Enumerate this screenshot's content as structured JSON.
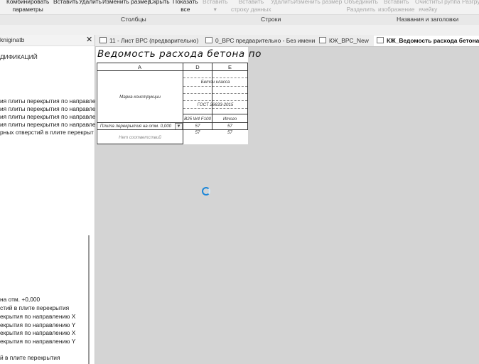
{
  "ribbon": {
    "buttons": [
      {
        "label": "Комбинировать\nпараметры",
        "enabled": true
      },
      {
        "label": "Вставить",
        "enabled": true
      },
      {
        "label": "Удалить",
        "enabled": true
      },
      {
        "label": "Изменить размер",
        "enabled": true
      },
      {
        "label": "Скрыть",
        "enabled": true
      },
      {
        "label": "Показать\nвсе",
        "enabled": true
      },
      {
        "label": "Вставить\n▾",
        "enabled": false
      },
      {
        "label": "Вставить\nстроку данных",
        "enabled": false
      },
      {
        "label": "Удалить",
        "enabled": false
      },
      {
        "label": "Изменить размер",
        "enabled": false
      },
      {
        "label": "Объединить\nРазделить",
        "enabled": false
      },
      {
        "label": "Вставить\nизображение",
        "enabled": false
      },
      {
        "label": "Очистить\nячейку",
        "enabled": false
      },
      {
        "label": "Группа",
        "enabled": false
      },
      {
        "label": "Разгру",
        "enabled": false
      }
    ],
    "groups": [
      "Столбцы",
      "Строки",
      "Названия и заголовки"
    ]
  },
  "left_panel": {
    "title": "kniginatb",
    "close_icon": "close-icon",
    "items_top": [
      "ДИФИКАЦИЙ",
      "ия плиты перекрытия по направле",
      "ия плиты перекрытия по направле",
      "ия плиты перекрытия по направле",
      "ия плиты перекрытия по направле",
      "рных отверстий в плите перекрыт"
    ],
    "items_bottom": [
      "на отм. +0,000",
      "стий в плите перекрытия",
      "екрытия по направлению X",
      "екрытия по направлению Y",
      "екрытия по направлению X",
      "екрытия по направлению Y",
      "й в плите перекрытия"
    ]
  },
  "tabs": [
    {
      "label": "11 - Лист ВРС (предварительно)",
      "icon": "sheet-icon",
      "active": false
    },
    {
      "label": "0_ВРС предварительно - Без имени",
      "icon": "view-icon",
      "active": false
    },
    {
      "label": "КЖ_ВРС_New",
      "icon": "schedule-icon",
      "active": false
    },
    {
      "label": "КЖ_Ведомость расхода бетона...",
      "icon": "schedule-icon",
      "active": true
    }
  ],
  "schedule": {
    "title": "Ведомость расхода бетона по",
    "columns": [
      "A",
      "D",
      "E"
    ],
    "header_a": "Марка конструкции",
    "header_concrete": "Бетон класса",
    "header_gost": "ГОСТ 26633-2015",
    "header_grade": "В25 W4 F100",
    "header_total": "Итого",
    "rows": [
      {
        "a": "Плита перекрытия на отм. 0,000",
        "d": "57",
        "e": "57"
      },
      {
        "a": "Нет соответствий",
        "d": "57",
        "e": "57"
      }
    ]
  },
  "colors": {
    "spinner": "#1a86d8",
    "canvas": "#d4d4d4"
  }
}
